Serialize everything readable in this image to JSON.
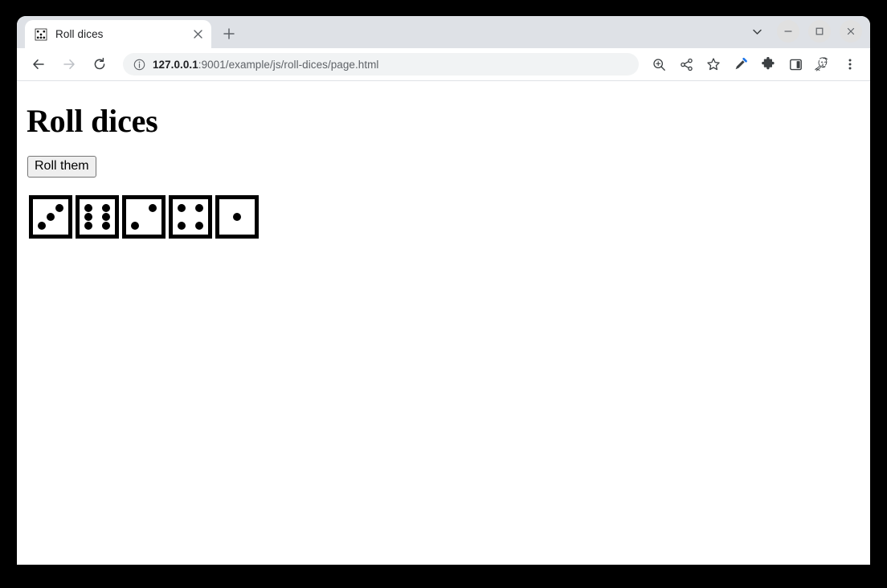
{
  "window": {
    "controls": {
      "tab_search_label": "tab-search",
      "minimize_label": "—",
      "maximize_label": "☐",
      "close_label": "×"
    }
  },
  "tabstrip": {
    "tabs": [
      {
        "title": "Roll dices",
        "favicon": "dice-favicon",
        "close_label": "×",
        "active": true
      }
    ],
    "new_tab_label": "+"
  },
  "toolbar": {
    "back_label": "back-arrow",
    "forward_label": "forward-arrow",
    "reload_label": "reload",
    "omnibox": {
      "info_icon": "info-circle-icon",
      "host": "127.0.0.1",
      "rest": ":9001/example/js/roll-dices/page.html",
      "full_url": "127.0.0.1:9001/example/js/roll-dices/page.html"
    },
    "icons": [
      "zoom-in-icon",
      "share-icon",
      "bookmark-star-icon",
      "eyedropper-icon",
      "extensions-puzzle-icon",
      "side-panel-icon"
    ],
    "avatar_label": "profile-avatar",
    "menu_label": "three-dot-menu"
  },
  "page": {
    "heading": "Roll dices",
    "button_label": "Roll them",
    "dice": [
      {
        "value": 3,
        "pips": [
          "p-bl",
          "p-c",
          "p-tr"
        ]
      },
      {
        "value": 6,
        "pips": [
          "p-tl",
          "p-tr",
          "p-ml",
          "p-mr",
          "p-bl",
          "p-br"
        ]
      },
      {
        "value": 2,
        "pips": [
          "p-bl",
          "p-tr"
        ]
      },
      {
        "value": 4,
        "pips": [
          "p-tl",
          "p-tr",
          "p-bl",
          "p-br"
        ]
      },
      {
        "value": 1,
        "pips": [
          "p-c"
        ]
      }
    ],
    "dice_values_text": "3, 6, 2, 4, 1"
  },
  "colors": {
    "tabstrip_bg": "#dee1e6",
    "toolbar_bg": "#ffffff",
    "omnibox_bg": "#f1f3f4",
    "page_bg": "#ffffff",
    "button_bg": "#efefef",
    "button_border": "#767676",
    "die_color": "#000000",
    "desktop_bg": "#000000",
    "eyedropper_accent": "#1a73e8"
  }
}
